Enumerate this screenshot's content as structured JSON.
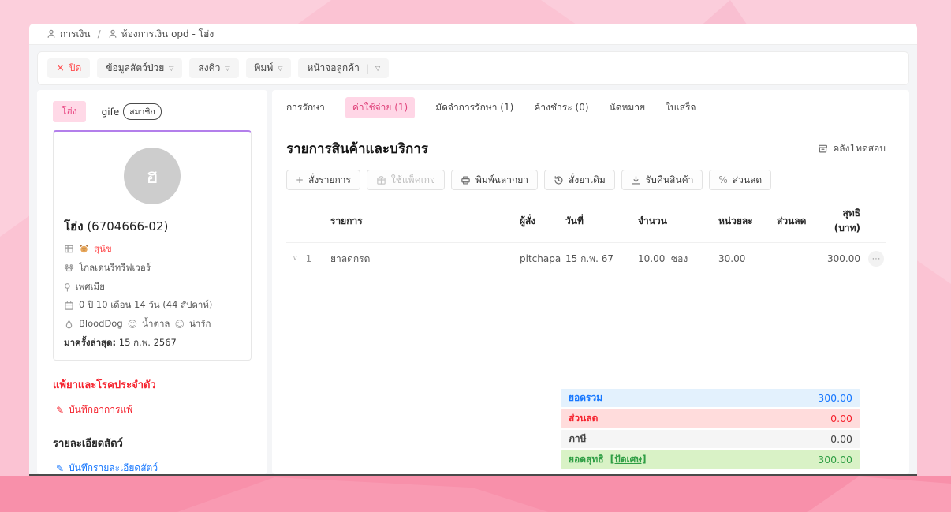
{
  "breadcrumb": {
    "items": [
      {
        "label": "การเงิน"
      },
      {
        "label": "ห้องการเงิน opd - โฮ่ง"
      }
    ],
    "separator": "/"
  },
  "toolbar": {
    "close_label": "ปิด",
    "patient_data_label": "ข้อมูลสัตว์ป่วย",
    "send_queue_label": "ส่งคิว",
    "print_label": "พิมพ์",
    "customer_screen_label": "หน้าจอลูกค้า"
  },
  "sidebar": {
    "tabs": [
      {
        "label": "โฮ่ง"
      },
      {
        "label": "gife",
        "badge": "สมาชิก"
      }
    ],
    "patient": {
      "avatar_letter": "ฮ",
      "name": "โฮ่ง",
      "id": "(6704666-02)",
      "species": "สุนัข",
      "breed": "โกลเดนรีทรีฟเวอร์",
      "gender": "เพศเมีย",
      "age": "0 ปี 10 เดือน 14 วัน (44 สัปดาห์)",
      "blood": "BloodDog",
      "color": "น้ำตาล",
      "trait": "น่ารัก",
      "last_visit_label": "มาครั้งล่าสุด:",
      "last_visit": "15 ก.พ. 2567"
    },
    "allergy_title": "แพ้ยาและโรคประจำตัว",
    "allergy_link": "บันทึกอาการแพ้",
    "details_title": "รายละเอียดสัตว์",
    "details_link": "บันทึกรายละเอียดสัตว์"
  },
  "main": {
    "tabs": [
      {
        "label": "การรักษา"
      },
      {
        "label": "ค่าใช้จ่าย (1)"
      },
      {
        "label": "มัดจำการรักษา (1)"
      },
      {
        "label": "ค้างชำระ (0)"
      },
      {
        "label": "นัดหมาย"
      },
      {
        "label": "ใบเสร็จ"
      }
    ],
    "title": "รายการสินค้าและบริการ",
    "warehouse": "คลัง1ทดสอบ",
    "actions": [
      "สั่งรายการ",
      "ใช้แพ็คเกจ",
      "พิมพ์ฉลากยา",
      "สั่งยาเดิม",
      "รับคืนสินค้า",
      "ส่วนลด"
    ],
    "table": {
      "headers": [
        "รายการ",
        "ผู้สั่ง",
        "วันที่",
        "จำนวน",
        "หน่วยละ",
        "ส่วนลด",
        "สุทธิ (บาท)"
      ],
      "rows": [
        {
          "index": "1",
          "item": "ยาลดกรด",
          "orderer": "pitchapa",
          "date": "15 ก.พ. 67",
          "qty": "10.00",
          "qty_unit": "ซอง",
          "unit_price": "30.00",
          "discount": "",
          "total": "300.00"
        }
      ]
    },
    "summary": {
      "rows": [
        {
          "label": "ยอดรวม",
          "value": "300.00"
        },
        {
          "label": "ส่วนลด",
          "value": "0.00"
        },
        {
          "label": "ภาษี",
          "value": "0.00"
        },
        {
          "label": "ยอดสุทธิ",
          "link": "[ปัดเศษ]",
          "value": "300.00"
        }
      ]
    }
  },
  "colors": {
    "accent_pink": "#e0447c",
    "danger_red": "#f5222d",
    "link_blue": "#1677ff",
    "success_green": "#2f9e44",
    "card_top_border": "#b37feb"
  }
}
